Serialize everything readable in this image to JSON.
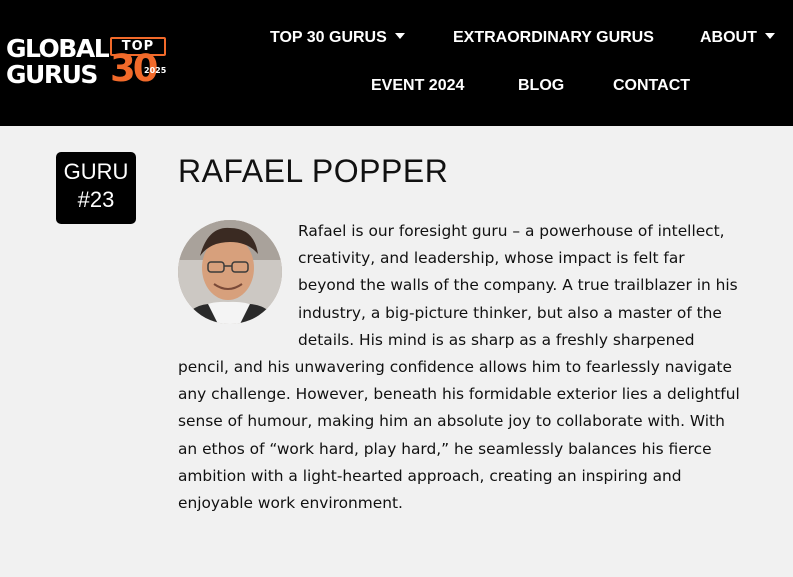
{
  "logo": {
    "word1": "GLOBAL",
    "word2": "GURUS",
    "top_label": "TOP",
    "number": "30",
    "year": "2025"
  },
  "nav": {
    "row1": [
      {
        "label": "TOP 30 GURUS",
        "has_dropdown": true
      },
      {
        "label": "EXTRAORDINARY GURUS",
        "has_dropdown": false
      },
      {
        "label": "ABOUT",
        "has_dropdown": true
      }
    ],
    "row2": [
      {
        "label": "EVENT 2024",
        "has_dropdown": false
      },
      {
        "label": "BLOG",
        "has_dropdown": false
      },
      {
        "label": "CONTACT",
        "has_dropdown": false
      }
    ]
  },
  "guru": {
    "badge_line1": "GURU",
    "badge_line2": "#23",
    "name": "RAFAEL POPPER",
    "bio": "Rafael is our foresight guru – a powerhouse of intellect, creativity, and leadership, whose impact is felt far beyond the walls of the company. A true trailblazer in his industry, a big-picture thinker, but also a master of the details. His mind is as sharp as a freshly sharpened pencil, and his unwavering confidence allows him to fearlessly navigate any challenge. However, beneath his formidable exterior lies a delightful sense of humour, making him an absolute joy to collaborate with. With an ethos of “work hard, play hard,” he seamlessly balances his fierce ambition with a light-hearted approach, creating an inspiring and enjoyable work environment."
  },
  "colors": {
    "header_bg": "#000000",
    "accent": "#f26a2a",
    "page_bg": "#f1f1f1"
  }
}
